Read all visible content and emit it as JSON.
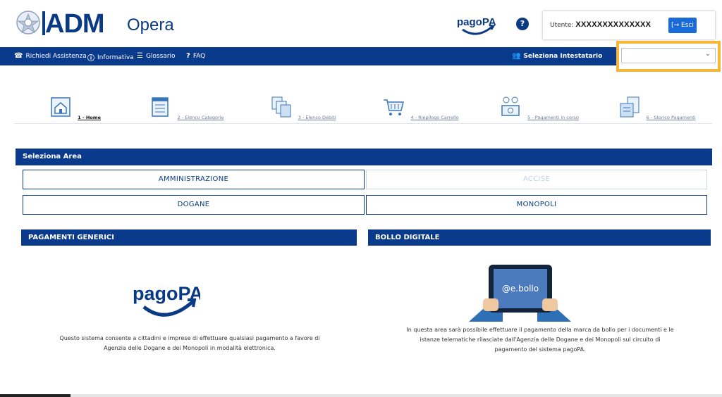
{
  "header": {
    "logo_text": "ADM",
    "app_name": "Opera",
    "pagopa_logo": "pagoPA",
    "user_label": "Utente:",
    "user_value": "XXXXXXXXXXXXXX",
    "exit_label": "Esci"
  },
  "nav": {
    "items": [
      {
        "icon": "phone-icon",
        "label": "Richiedi Assistenza"
      },
      {
        "icon": "info-icon",
        "label": "Informativa"
      },
      {
        "icon": "list-icon",
        "label": "Glossario"
      },
      {
        "icon": "question-icon",
        "label": "FAQ"
      }
    ],
    "intestatario_label": "Seleziona Intestatario",
    "intestatario_value": ""
  },
  "steps": [
    {
      "label": "1 - Home",
      "icon": "home-icon",
      "active": true
    },
    {
      "label": "2 - Elenco Categorie",
      "icon": "categories-icon",
      "active": false
    },
    {
      "label": "3 - Elenco Debiti",
      "icon": "debts-icon",
      "active": false
    },
    {
      "label": "4 - Riepilogo Carrello",
      "icon": "cart-icon",
      "active": false
    },
    {
      "label": "5 - Pagamenti in corso",
      "icon": "payments-icon",
      "active": false
    },
    {
      "label": "6 - Storico Pagamenti",
      "icon": "history-icon",
      "active": false
    }
  ],
  "area": {
    "title": "Seleziona Area",
    "buttons": [
      {
        "label": "AMMINISTRAZIONE",
        "enabled": true
      },
      {
        "label": "ACCISE",
        "enabled": false
      },
      {
        "label": "DOGANE",
        "enabled": true
      },
      {
        "label": "MONOPOLI",
        "enabled": true
      }
    ]
  },
  "pagamenti": {
    "title": "PAGAMENTI GENERICI",
    "logo": "pagoPA",
    "text_line1": "Questo sistema consente a cittadini e imprese di effettuare qualsiasi pagamento a favore di",
    "text_line2": "Agenzia delle Dogane e dei Monopoli in modalità elettronica."
  },
  "bollo": {
    "title": "BOLLO DIGITALE",
    "image_text": "@e.bollo",
    "text_line1": "In questa area sarà possibile effettuare il pagamento della marca da bollo per i documenti e le",
    "text_line2": "istanze telematiche rilasciate dall'Agenzia delle Dogane e dei Monopoli sul circuito di",
    "text_line3": "pagamento del sistema pagoPA."
  },
  "colors": {
    "primary": "#0a3a8c",
    "accent": "#1a6bd8",
    "highlight": "#f4b73a"
  }
}
